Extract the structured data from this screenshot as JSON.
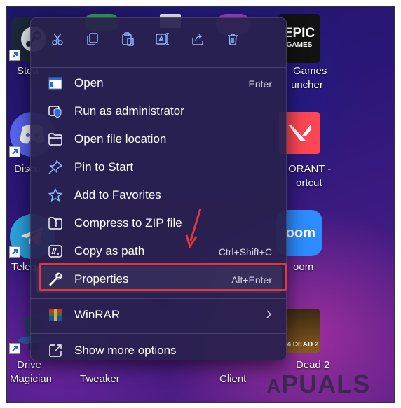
{
  "desktop": {
    "icons": [
      {
        "name": "steam-icon",
        "label": "Stea"
      },
      {
        "name": "discord-icon",
        "label": "Disco"
      },
      {
        "name": "telegram-icon",
        "label": "Teleg"
      },
      {
        "name": "drive-magician-icon",
        "label_line1": "Drive",
        "label_line2": "Magician"
      },
      {
        "name": "tweaker-icon",
        "label": "Tweaker"
      },
      {
        "name": "client-icon",
        "label": "Client"
      },
      {
        "name": "epic-games-icon",
        "logo_text_top": "EPIC",
        "logo_text_bottom": "GAMES",
        "label_line1": "Games",
        "label_line2": "uncher"
      },
      {
        "name": "valorant-icon",
        "label_line1": "ORANT -",
        "label_line2": "ortcut"
      },
      {
        "name": "zoom-icon",
        "logo_text": "oom",
        "label": "oom"
      },
      {
        "name": "left-4-dead-2-icon",
        "logo_text": "4 DEAD 2",
        "label": "Dead 2"
      }
    ]
  },
  "context_menu": {
    "toolbar": [
      {
        "name": "cut-icon"
      },
      {
        "name": "copy-icon"
      },
      {
        "name": "paste-icon"
      },
      {
        "name": "rename-icon"
      },
      {
        "name": "share-icon"
      },
      {
        "name": "delete-icon"
      }
    ],
    "items": [
      {
        "label": "Open",
        "shortcut": "Enter",
        "icon": "open-window-icon"
      },
      {
        "label": "Run as administrator",
        "shortcut": "",
        "icon": "shield-icon"
      },
      {
        "label": "Open file location",
        "shortcut": "",
        "icon": "folder-icon"
      },
      {
        "label": "Pin to Start",
        "shortcut": "",
        "icon": "pin-icon"
      },
      {
        "label": "Add to Favorites",
        "shortcut": "",
        "icon": "star-icon"
      },
      {
        "label": "Compress to ZIP file",
        "shortcut": "",
        "icon": "zip-folder-icon"
      },
      {
        "label": "Copy as path",
        "shortcut": "Ctrl+Shift+C",
        "icon": "copy-path-icon"
      },
      {
        "label": "Properties",
        "shortcut": "Alt+Enter",
        "icon": "wrench-icon"
      }
    ],
    "winrar": {
      "label": "WinRAR",
      "icon": "winrar-icon"
    },
    "show_more": {
      "label": "Show more options",
      "icon": "external-icon"
    }
  },
  "annotation": {
    "highlight_color": "#e0383d"
  },
  "watermark": {
    "text": "PUALS",
    "prefix": "A"
  }
}
